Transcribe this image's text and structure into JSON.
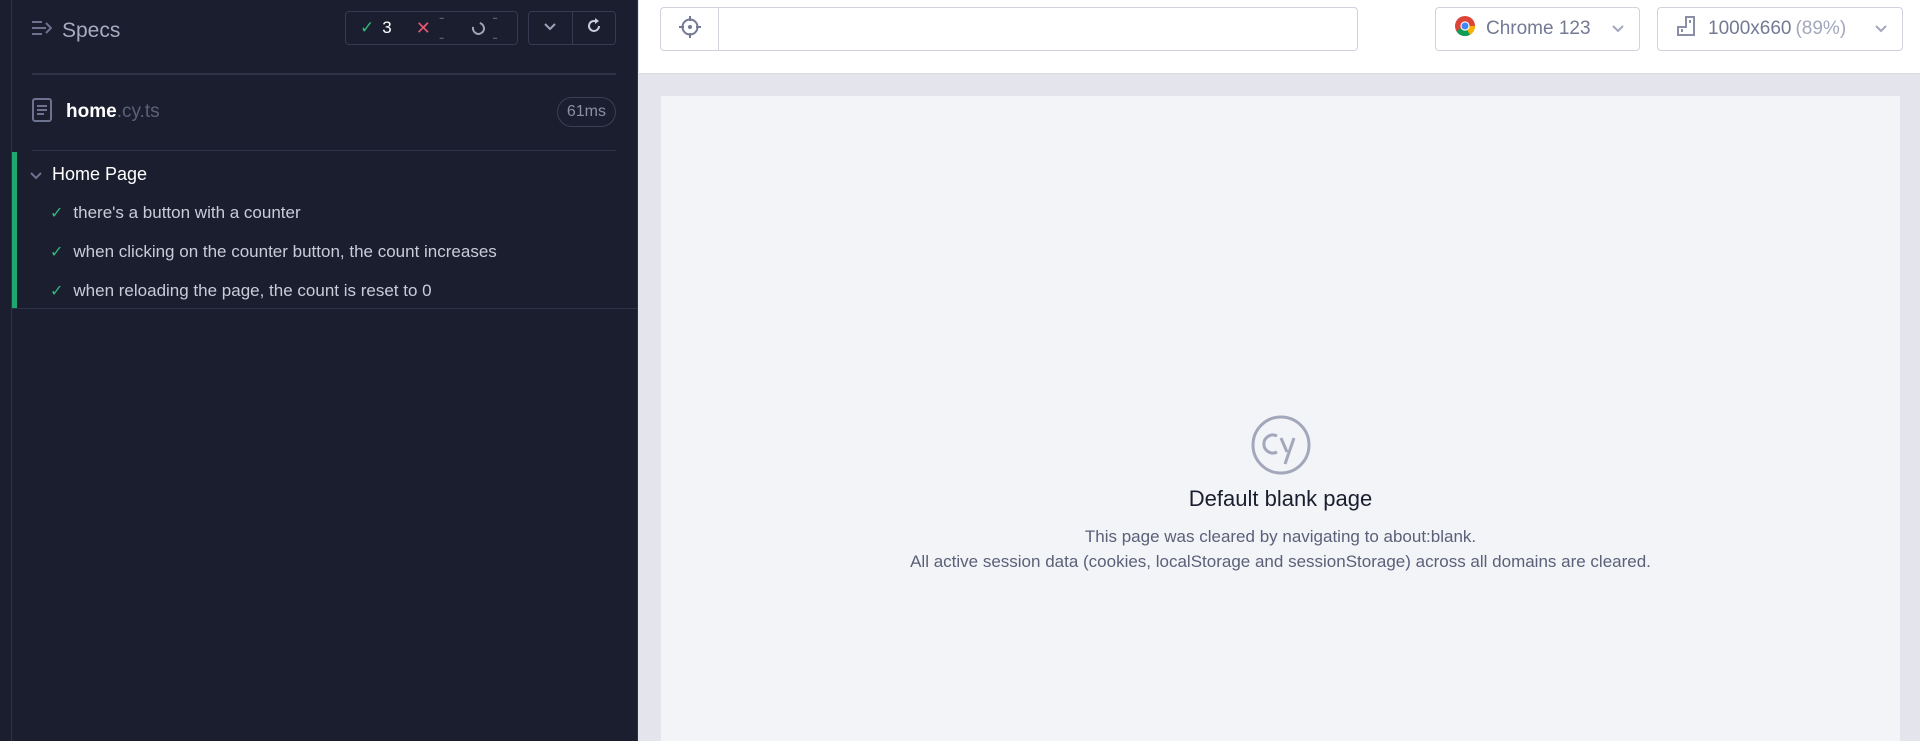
{
  "reporter": {
    "specs_label": "Specs",
    "stats": {
      "passed": "3",
      "failed": "--",
      "pending": "--"
    },
    "file": {
      "name": "home",
      "ext": ".cy.ts",
      "duration": "61ms"
    },
    "suite": {
      "title": "Home Page",
      "tests": [
        "there's a button with a counter",
        "when clicking on the counter button, the count increases",
        "when reloading the page, the count is reset to 0"
      ]
    }
  },
  "toolbar": {
    "url_value": "",
    "browser_label": "Chrome 123",
    "viewport_size": "1000x660",
    "viewport_scale": "(89%)"
  },
  "aut": {
    "title": "Default blank page",
    "line1": "This page was cleared by navigating to about:blank.",
    "line2": "All active session data (cookies, localStorage and sessionStorage) across all domains are cleared."
  },
  "colors": {
    "reporter_bg": "#1b1e2e",
    "pass": "#2fb97b",
    "fail": "#e45770",
    "aut_bg": "#f3f4f8"
  }
}
